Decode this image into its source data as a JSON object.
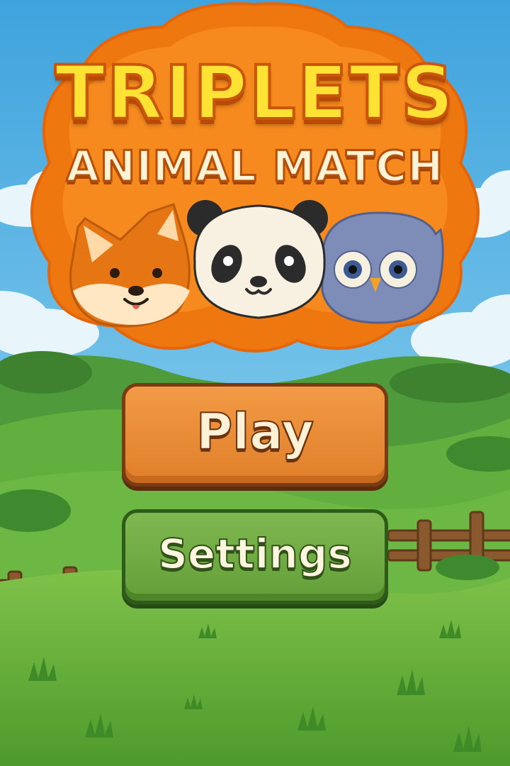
{
  "logo": {
    "title": "TRIPLETS",
    "subtitle": "ANIMAL MATCH",
    "mascots": [
      "fox",
      "panda",
      "owl"
    ]
  },
  "menu": {
    "play_label": "Play",
    "settings_label": "Settings"
  },
  "colors": {
    "sky": "#4FB0E0",
    "grass": "#6DBA3E",
    "logo_orange": "#F07A10",
    "title_yellow": "#FFE234",
    "play_button": "#E88A35",
    "settings_button": "#6FA842",
    "fence": "#8A5A2E"
  }
}
